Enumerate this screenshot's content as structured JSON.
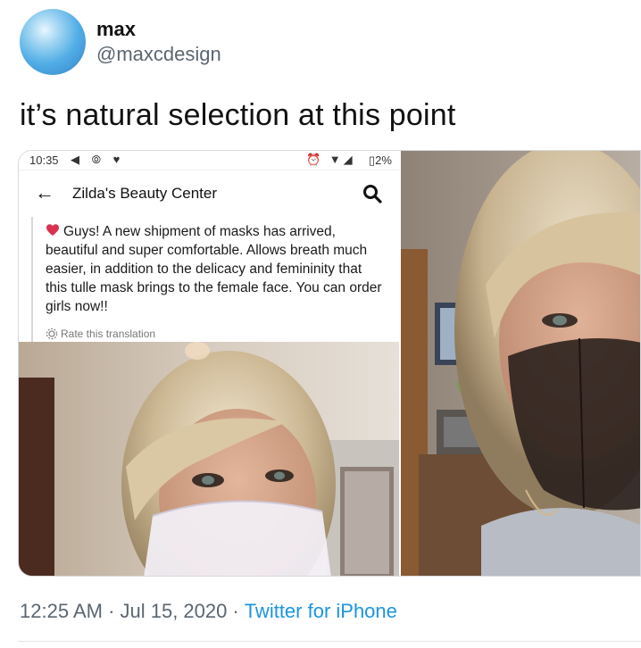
{
  "tweet": {
    "display_name": "max",
    "handle": "@maxcdesign",
    "text": "it’s natural selection at this point",
    "timestamp": "12:25 AM · Jul 15, 2020",
    "separator": "·",
    "source": "Twitter for iPhone"
  },
  "screenshot": {
    "status_bar": {
      "time": "10:35",
      "left_icons": "◀ ⦾ ♥",
      "right_icons": "⏰ ▼◢",
      "battery": "▯2%"
    },
    "app_bar": {
      "back_icon": "arrow-left-icon",
      "title": "Zilda's Beauty Center",
      "search_icon": "search-icon"
    },
    "post": {
      "text": "Guys! A new shipment of masks has arrived, beautiful and super comfortable. Allows breath much easier, in addition to the delicacy and femininity that this tulle mask brings to the female face. You can order girls now!!",
      "translate_label": "Rate this translation"
    }
  },
  "colors": {
    "link": "#1b95e0",
    "secondary_text": "#5b6670",
    "heart": "#d8324e"
  }
}
